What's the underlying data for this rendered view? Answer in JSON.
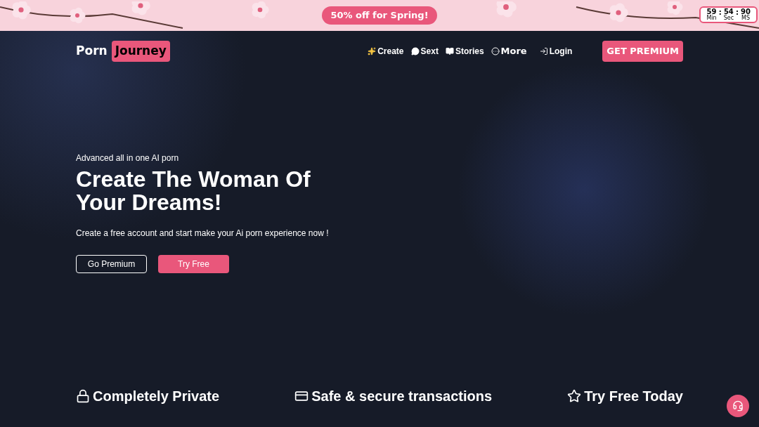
{
  "promo_banner": {
    "label": "50% off for Spring!",
    "timer": [
      {
        "value": "59",
        "unit": "Min"
      },
      {
        "value": "54",
        "unit": "Sec"
      },
      {
        "value": "90",
        "unit": "MS"
      }
    ],
    "separator": ":"
  },
  "header": {
    "logo": {
      "first": "Porn",
      "second": "Journey"
    },
    "nav": [
      {
        "label": "Create",
        "kind": "sparkles"
      },
      {
        "label": "Sext",
        "kind": "chat"
      },
      {
        "label": "Stories",
        "kind": "book"
      },
      {
        "label": "More",
        "kind": "more"
      },
      {
        "label": "Login",
        "kind": "login"
      }
    ],
    "cta": "GET PREMIUM"
  },
  "hero": {
    "eyebrow": "Advanced all in one AI porn",
    "title": "Create The Woman Of Your Dreams!",
    "subtitle": "Create a free account and start make your Ai porn experience now !",
    "buttons": [
      {
        "label": "Go Premium",
        "kind": "outline"
      },
      {
        "label": "Try Free",
        "kind": "filled"
      }
    ]
  },
  "features": [
    {
      "label": "Completely Private",
      "kind": "lock"
    },
    {
      "label": "Safe & secure transactions",
      "kind": "card"
    },
    {
      "label": "Try Free Today",
      "kind": "star"
    }
  ]
}
